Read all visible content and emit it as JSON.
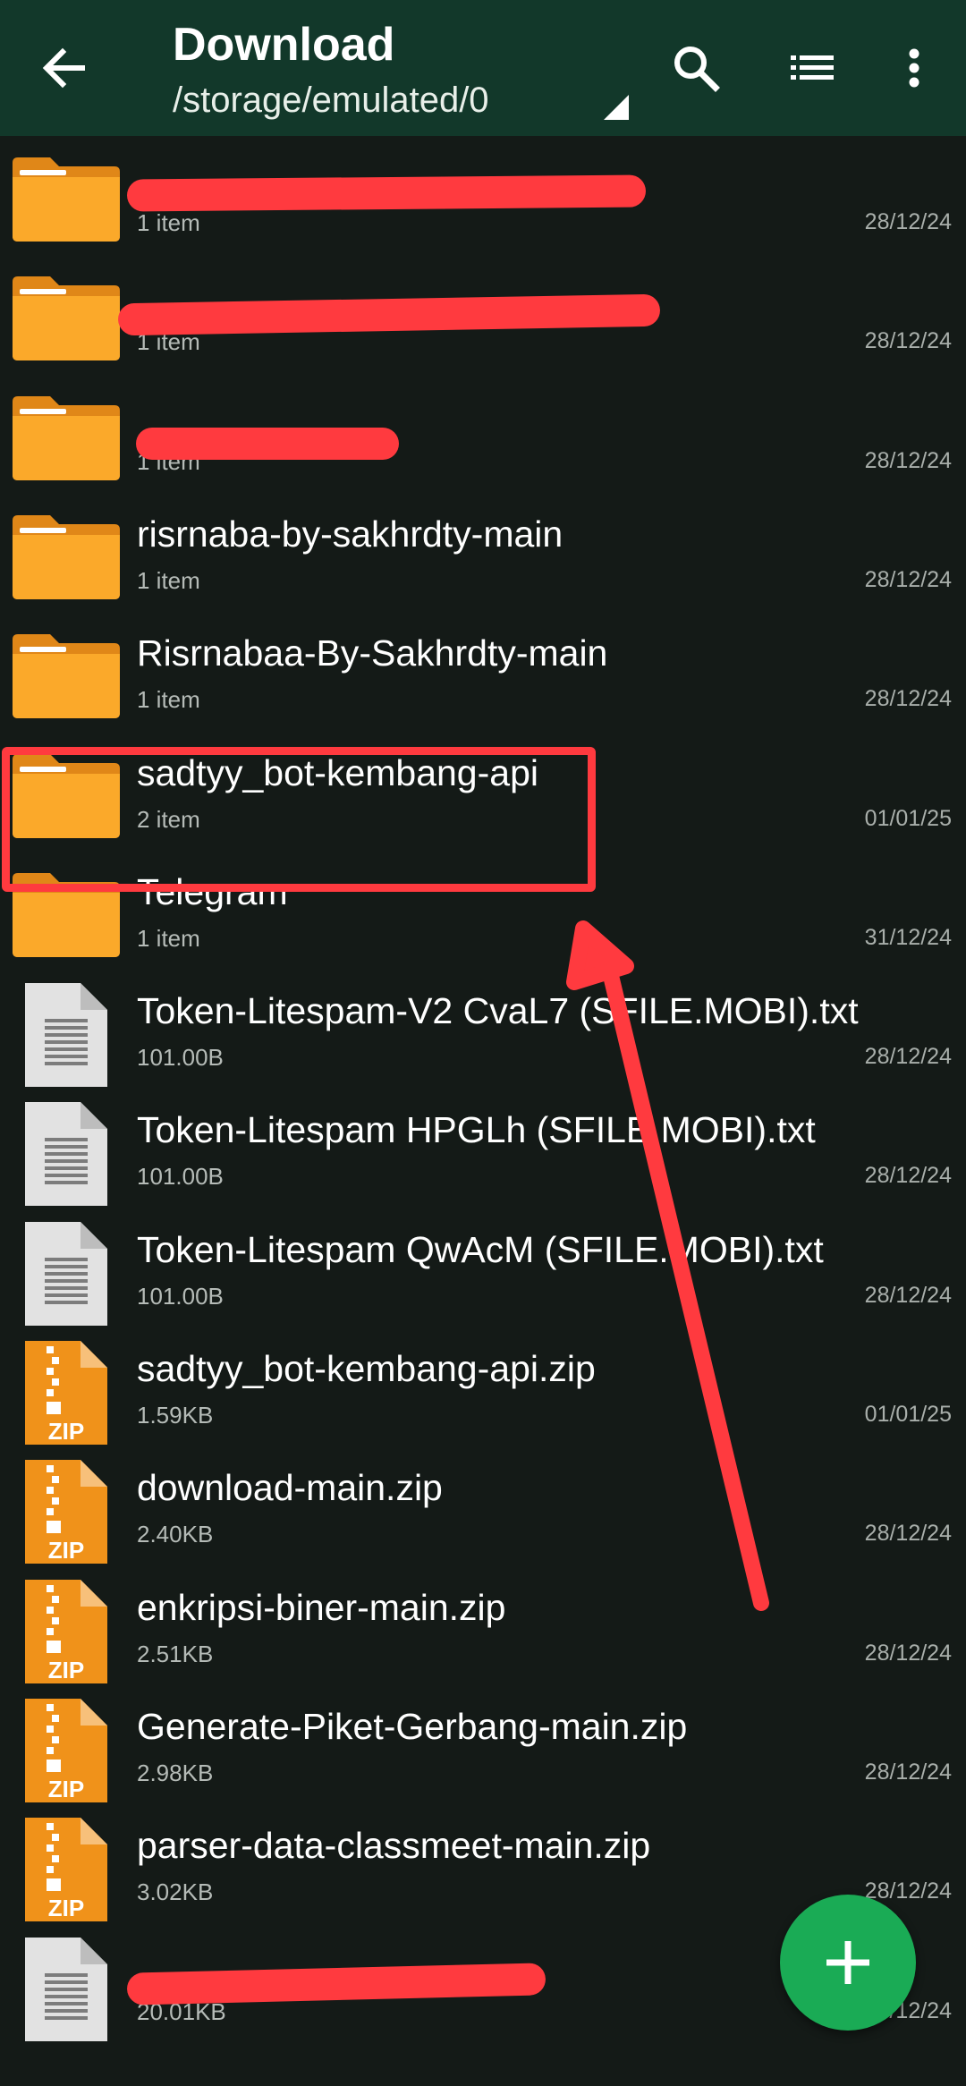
{
  "topbar": {
    "title": "Download",
    "path": "/storage/emulated/0",
    "icons": [
      "back-arrow-icon",
      "search-icon",
      "list-view-icon",
      "more-vert-icon"
    ]
  },
  "colors": {
    "topbar_bg": "#12382a",
    "list_bg": "#141a17",
    "folder": "#fba92a",
    "zip": "#f0921a",
    "annotation_red": "#ff3a3f",
    "fab": "#1aab55"
  },
  "files": [
    {
      "type": "folder",
      "name": "",
      "meta": "1 item",
      "date": "28/12/24",
      "redacted": true
    },
    {
      "type": "folder",
      "name": "",
      "meta": "1 item",
      "date": "28/12/24",
      "redacted": true
    },
    {
      "type": "folder",
      "name": "",
      "meta": "1 item",
      "date": "28/12/24",
      "redacted": true
    },
    {
      "type": "folder",
      "name": "risrnaba-by-sakhrdty-main",
      "meta": "1 item",
      "date": "28/12/24"
    },
    {
      "type": "folder",
      "name": "Risrnabaa-By-Sakhrdty-main",
      "meta": "1 item",
      "date": "28/12/24"
    },
    {
      "type": "folder",
      "name": "sadtyy_bot-kembang-api",
      "meta": "2 item",
      "date": "01/01/25",
      "highlighted": true
    },
    {
      "type": "folder",
      "name": "Telegram",
      "meta": "1 item",
      "date": "31/12/24"
    },
    {
      "type": "text",
      "name": "Token-Litespam-V2 CvaL7 (SFILE.MOBI).txt",
      "meta": "101.00B",
      "date": "28/12/24"
    },
    {
      "type": "text",
      "name": "Token-Litespam HPGLh (SFILE.MOBI).txt",
      "meta": "101.00B",
      "date": "28/12/24"
    },
    {
      "type": "text",
      "name": "Token-Litespam QwAcM (SFILE.MOBI).txt",
      "meta": "101.00B",
      "date": "28/12/24"
    },
    {
      "type": "zip",
      "name": "sadtyy_bot-kembang-api.zip",
      "meta": "1.59KB",
      "date": "01/01/25"
    },
    {
      "type": "zip",
      "name": "download-main.zip",
      "meta": "2.40KB",
      "date": "28/12/24"
    },
    {
      "type": "zip",
      "name": "enkripsi-biner-main.zip",
      "meta": "2.51KB",
      "date": "28/12/24"
    },
    {
      "type": "zip",
      "name": "Generate-Piket-Gerbang-main.zip",
      "meta": "2.98KB",
      "date": "28/12/24"
    },
    {
      "type": "zip",
      "name": "parser-data-classmeet-main.zip",
      "meta": "3.02KB",
      "date": "28/12/24"
    },
    {
      "type": "text",
      "name": "",
      "meta": "20.01KB",
      "date": "29/12/24",
      "redacted": true
    }
  ],
  "zip_label": "ZIP",
  "fab_icon": "plus-icon"
}
